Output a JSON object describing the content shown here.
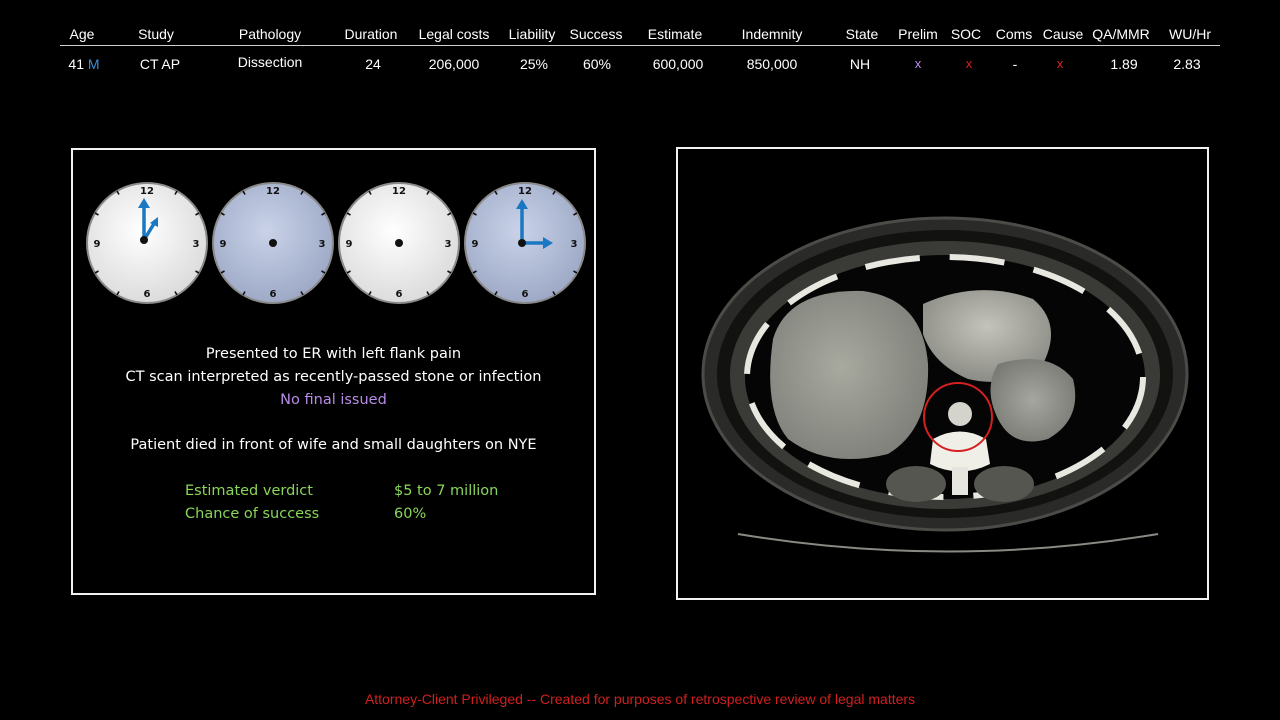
{
  "header": {
    "columns": [
      "Age",
      "Study",
      "Pathology",
      "Duration",
      "Legal costs",
      "Liability",
      "Success",
      "Estimate",
      "Indemnity",
      "State",
      "Prelim",
      "SOC",
      "Coms",
      "Cause",
      "QA/MMR",
      "WU/Hr"
    ],
    "row": {
      "age": "41",
      "sex": "M",
      "study": "CT AP",
      "pathology": "Dissection",
      "duration": "24",
      "legal_costs": "206,000",
      "liability": "25%",
      "success": "60%",
      "estimate": "600,000",
      "indemnity": "850,000",
      "state": "NH",
      "prelim": "x",
      "soc": "x",
      "coms": "-",
      "cause": "x",
      "qa_mmr": "1.89",
      "wu_hr": "2.83"
    }
  },
  "clocks": [
    {
      "face": "white",
      "hands": "12-1",
      "label_12": "12",
      "label_3": "3",
      "label_6": "6",
      "label_9": "9"
    },
    {
      "face": "blue",
      "hands": "none",
      "label_12": "12",
      "label_3": "3",
      "label_6": "6",
      "label_9": "9"
    },
    {
      "face": "white",
      "hands": "none",
      "label_12": "12",
      "label_3": "3",
      "label_6": "6",
      "label_9": "9"
    },
    {
      "face": "blue",
      "hands": "3-00",
      "label_12": "12",
      "label_3": "3",
      "label_6": "6",
      "label_9": "9"
    }
  ],
  "case": {
    "line1": "Presented to ER with left flank pain",
    "line2": "CT scan interpreted as recently-passed stone or infection",
    "line3": "No final issued",
    "line4": "Patient died in front of wife and small daughters on NYE",
    "verdict_label": "Estimated verdict",
    "verdict_value": "$5 to 7 million",
    "success_label": "Chance of success",
    "success_value": "60%"
  },
  "footer": "Attorney-Client Privileged -- Created for purposes of retrospective review of legal matters",
  "colors": {
    "accent_blue": "#1a78c2",
    "purple_text": "#b98ce8",
    "green_text": "#88d65a",
    "red_mark": "#e02020",
    "footer_red": "#d21f1f",
    "clock_white": "#f0f0f0",
    "clock_blue": "#b8c3dc"
  }
}
